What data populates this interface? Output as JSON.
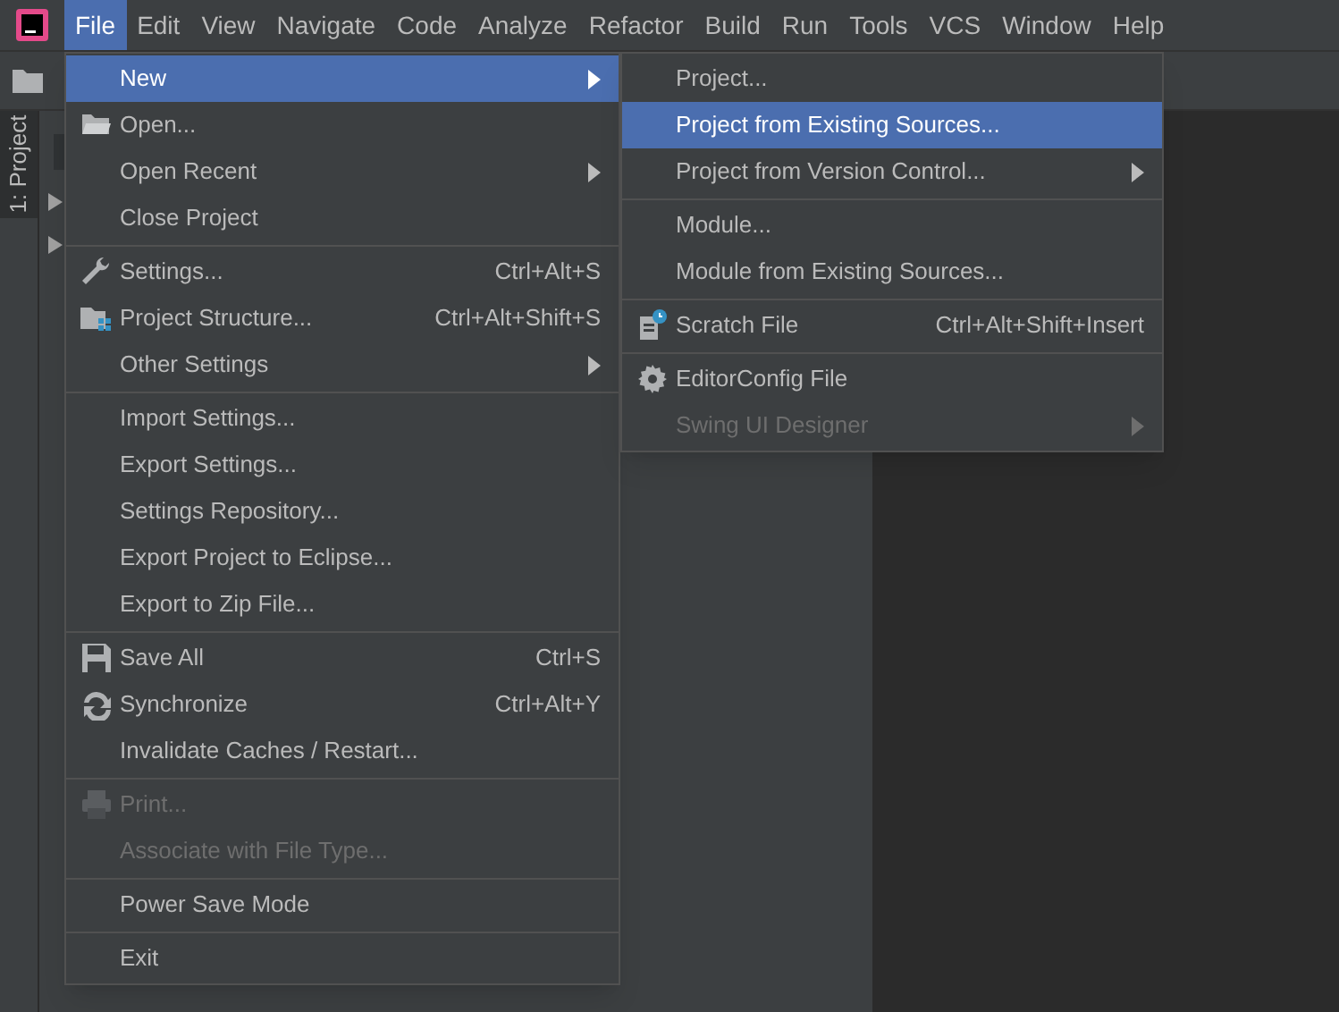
{
  "menubar": [
    {
      "label": "File",
      "selected": true
    },
    {
      "label": "Edit",
      "selected": false
    },
    {
      "label": "View",
      "selected": false
    },
    {
      "label": "Navigate",
      "selected": false
    },
    {
      "label": "Code",
      "selected": false
    },
    {
      "label": "Analyze",
      "selected": false
    },
    {
      "label": "Refactor",
      "selected": false
    },
    {
      "label": "Build",
      "selected": false
    },
    {
      "label": "Run",
      "selected": false
    },
    {
      "label": "Tools",
      "selected": false
    },
    {
      "label": "VCS",
      "selected": false
    },
    {
      "label": "Window",
      "selected": false
    },
    {
      "label": "Help",
      "selected": false
    }
  ],
  "tool_window_tab": {
    "label": "1: Project",
    "selected": true
  },
  "file_menu": [
    {
      "kind": "item",
      "label": "New",
      "submenu": true,
      "selected": true,
      "disabled": false
    },
    {
      "kind": "item",
      "label": "Open...",
      "selected": false,
      "disabled": false
    },
    {
      "kind": "item",
      "label": "Open Recent",
      "submenu": true,
      "selected": false,
      "disabled": false
    },
    {
      "kind": "item",
      "label": "Close Project",
      "selected": false,
      "disabled": false
    },
    {
      "kind": "separator"
    },
    {
      "kind": "item",
      "label": "Settings...",
      "shortcut": "Ctrl+Alt+S",
      "selected": false,
      "disabled": false
    },
    {
      "kind": "item",
      "label": "Project Structure...",
      "shortcut": "Ctrl+Alt+Shift+S",
      "selected": false,
      "disabled": false
    },
    {
      "kind": "item",
      "label": "Other Settings",
      "submenu": true,
      "selected": false,
      "disabled": false
    },
    {
      "kind": "separator"
    },
    {
      "kind": "item",
      "label": "Import Settings...",
      "selected": false,
      "disabled": false
    },
    {
      "kind": "item",
      "label": "Export Settings...",
      "selected": false,
      "disabled": false
    },
    {
      "kind": "item",
      "label": "Settings Repository...",
      "selected": false,
      "disabled": false
    },
    {
      "kind": "item",
      "label": "Export Project to Eclipse...",
      "selected": false,
      "disabled": false
    },
    {
      "kind": "item",
      "label": "Export to Zip File...",
      "selected": false,
      "disabled": false
    },
    {
      "kind": "separator"
    },
    {
      "kind": "item",
      "label": "Save All",
      "shortcut": "Ctrl+S",
      "selected": false,
      "disabled": false
    },
    {
      "kind": "item",
      "label": "Synchronize",
      "shortcut": "Ctrl+Alt+Y",
      "selected": false,
      "disabled": false
    },
    {
      "kind": "item",
      "label": "Invalidate Caches / Restart...",
      "selected": false,
      "disabled": false
    },
    {
      "kind": "separator"
    },
    {
      "kind": "item",
      "label": "Print...",
      "selected": false,
      "disabled": true
    },
    {
      "kind": "item",
      "label": "Associate with File Type...",
      "selected": false,
      "disabled": true
    },
    {
      "kind": "separator"
    },
    {
      "kind": "item",
      "label": "Power Save Mode",
      "selected": false,
      "disabled": false
    },
    {
      "kind": "separator"
    },
    {
      "kind": "item",
      "label": "Exit",
      "selected": false,
      "disabled": false
    }
  ],
  "new_submenu": [
    {
      "kind": "item",
      "label": "Project...",
      "selected": false,
      "disabled": false
    },
    {
      "kind": "item",
      "label": "Project from Existing Sources...",
      "selected": true,
      "disabled": false
    },
    {
      "kind": "item",
      "label": "Project from Version Control...",
      "submenu": true,
      "selected": false,
      "disabled": false
    },
    {
      "kind": "separator"
    },
    {
      "kind": "item",
      "label": "Module...",
      "selected": false,
      "disabled": false
    },
    {
      "kind": "item",
      "label": "Module from Existing Sources...",
      "selected": false,
      "disabled": false
    },
    {
      "kind": "separator"
    },
    {
      "kind": "item",
      "label": "Scratch File",
      "shortcut": "Ctrl+Alt+Shift+Insert",
      "selected": false,
      "disabled": false
    },
    {
      "kind": "separator"
    },
    {
      "kind": "item",
      "label": "EditorConfig File",
      "selected": false,
      "disabled": false
    },
    {
      "kind": "item",
      "label": "Swing UI Designer",
      "submenu": true,
      "selected": false,
      "disabled": true
    }
  ]
}
